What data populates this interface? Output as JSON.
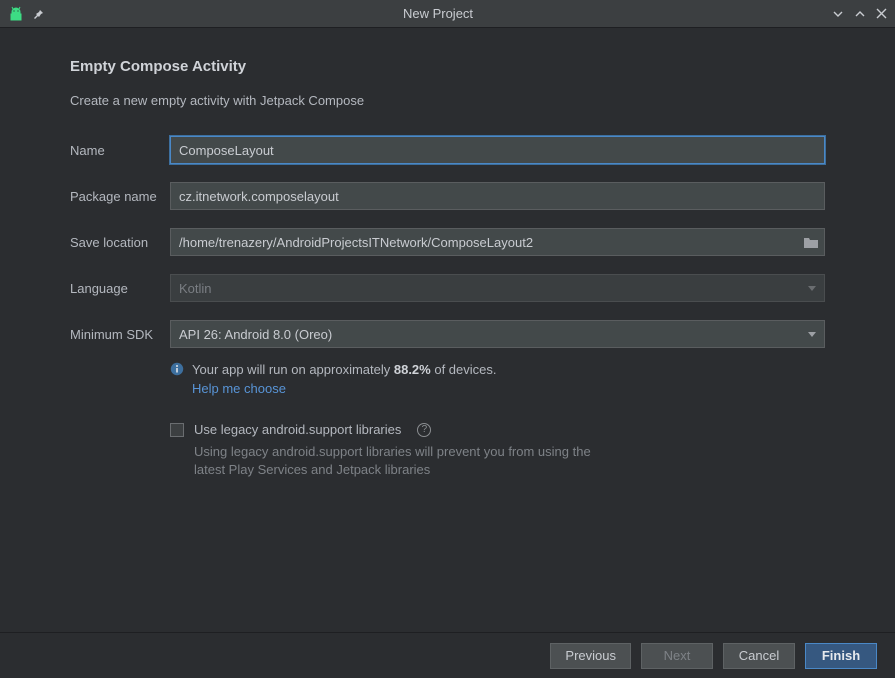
{
  "window": {
    "title": "New Project"
  },
  "page": {
    "heading": "Empty Compose Activity",
    "description": "Create a new empty activity with Jetpack Compose"
  },
  "form": {
    "name_label": "Name",
    "name_value": "ComposeLayout",
    "package_label": "Package name",
    "package_value": "cz.itnetwork.composelayout",
    "save_label": "Save location",
    "save_value": "/home/trenazery/AndroidProjectsITNetwork/ComposeLayout2",
    "language_label": "Language",
    "language_value": "Kotlin",
    "minsdk_label": "Minimum SDK",
    "minsdk_value": "API 26: Android 8.0 (Oreo)"
  },
  "info": {
    "prefix": "Your app will run on approximately ",
    "percent": "88.2%",
    "suffix": " of devices.",
    "help_link": "Help me choose"
  },
  "legacy": {
    "checkbox_label": "Use legacy android.support libraries",
    "desc": "Using legacy android.support libraries will prevent you from using the latest Play Services and Jetpack libraries"
  },
  "footer": {
    "previous": "Previous",
    "next": "Next",
    "cancel": "Cancel",
    "finish": "Finish"
  }
}
